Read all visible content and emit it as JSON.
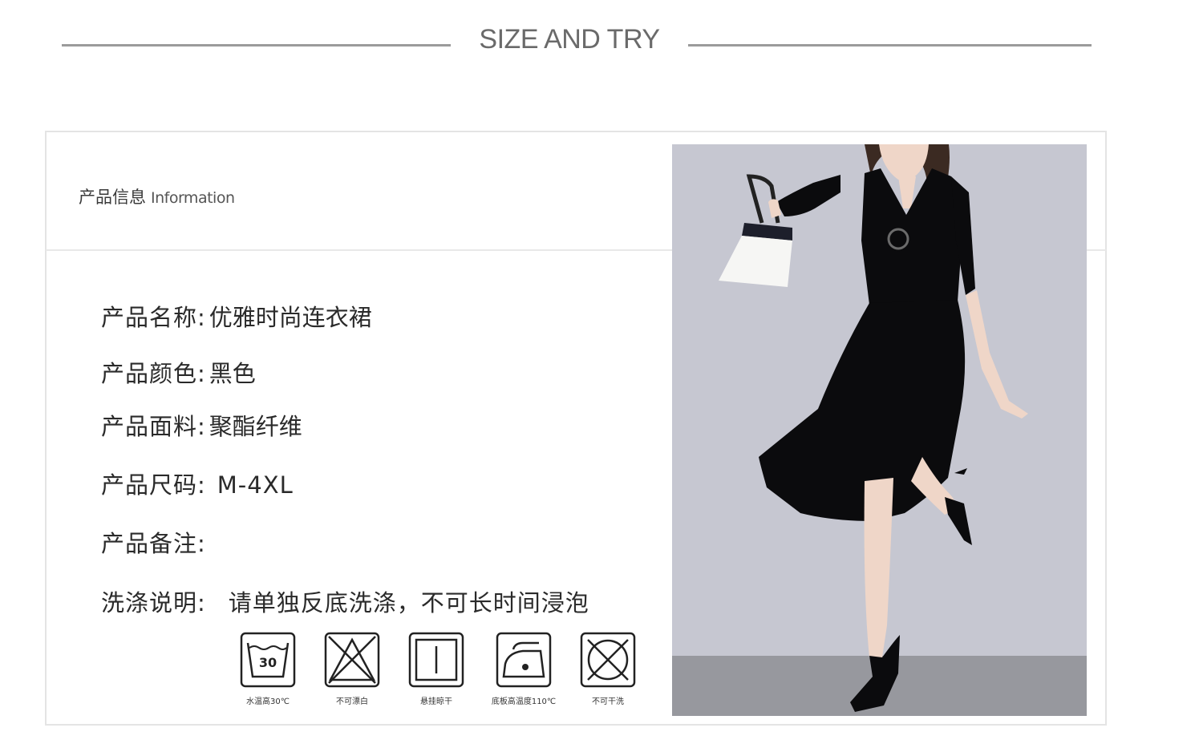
{
  "header": {
    "title": "SIZE AND TRY"
  },
  "info": {
    "title_cn": "产品信息",
    "title_en": "Information"
  },
  "rows": [
    {
      "label": "产品名称:",
      "value": "优雅时尚连衣裙"
    },
    {
      "label": "产品颜色:",
      "value": "黑色"
    },
    {
      "label": "产品面料:",
      "value": "聚酯纤维"
    },
    {
      "label": "产品尺码:",
      "value": "M-4XL"
    },
    {
      "label": "产品备注:",
      "value": ""
    },
    {
      "label": "洗涤说明:",
      "value": "请单独反底洗涤，不可长时间浸泡"
    }
  ],
  "care_icons": [
    {
      "icon": "wash-30-icon",
      "caption": "水温高30℃",
      "number": "30"
    },
    {
      "icon": "no-bleach-icon",
      "caption": "不可漂白"
    },
    {
      "icon": "hang-dry-icon",
      "caption": "悬挂晾干"
    },
    {
      "icon": "iron-icon",
      "caption": "底板高温度110℃"
    },
    {
      "icon": "no-dry-clean-icon",
      "caption": "不可干洗"
    }
  ],
  "colors": {
    "dress": "#0b0b0d",
    "backdrop": "#c5c6d0",
    "floor": "#97989e"
  }
}
